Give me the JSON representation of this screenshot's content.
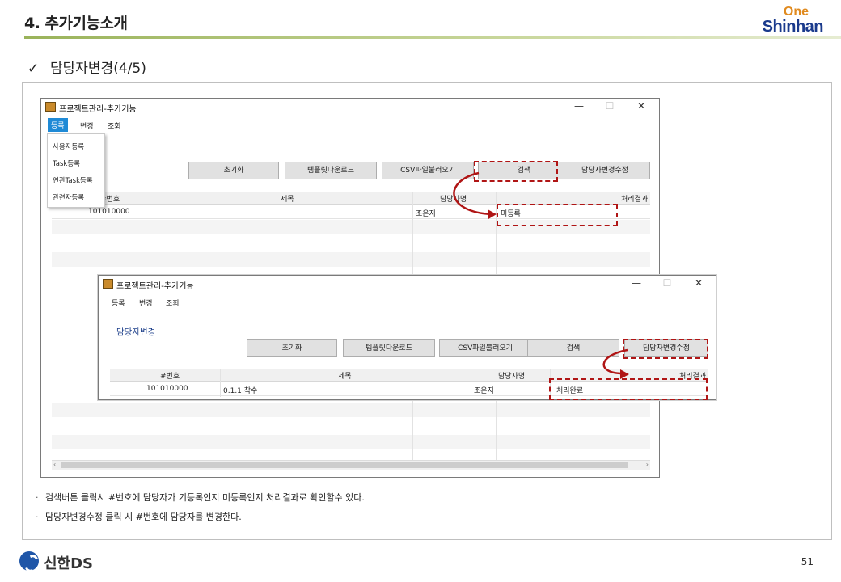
{
  "slide": {
    "title": "4. 추가기능소개",
    "subtitle": "담당자변경(4/5)",
    "check_glyph": "✓",
    "page_number": "51"
  },
  "brand": {
    "one": "One",
    "shinhan": "Shinhan",
    "footer": "신한DS"
  },
  "win1": {
    "title": "프로젝트관리-추가기능",
    "menu": [
      "등록",
      "변경",
      "조회"
    ],
    "dropdown": [
      "사용자등록",
      "Task등록",
      "연관Task등록",
      "관련자등록"
    ],
    "buttons": [
      "초기화",
      "템플릿다운로드",
      "CSV파일불러오기",
      "검색",
      "담당자변경수정"
    ],
    "columns": [
      "#번호",
      "제목",
      "담당자명",
      "처리결과"
    ],
    "row": {
      "no": "101010000",
      "title": "",
      "owner": "조은지",
      "result": "미등록"
    }
  },
  "win2": {
    "title": "프로젝트관리-추가기능",
    "menu": [
      "등록",
      "변경",
      "조회"
    ],
    "section": "담당자변경",
    "buttons": [
      "초기화",
      "템플릿다운로드",
      "CSV파일불러오기",
      "검색",
      "담당자변경수정"
    ],
    "columns": [
      "#번호",
      "제목",
      "담당자명",
      "처리결과"
    ],
    "row": {
      "no": "101010000",
      "title": "0.1.1 착수",
      "owner": "조은지",
      "result": "처리완료"
    }
  },
  "window_controls": {
    "min": "—",
    "max": "☐",
    "close": "✕"
  },
  "notes": [
    "검색버튼 클릭시 #번호에 담당자가 기등록인지 미등록인지 처리결과로 확인할수 있다.",
    "담당자변경수정 클릭 시 #번호에 담당자를 변경한다."
  ],
  "colors": {
    "accent_red": "#b01515",
    "menu_active": "#1f8ad6",
    "title_rule": "#9ab35a"
  }
}
